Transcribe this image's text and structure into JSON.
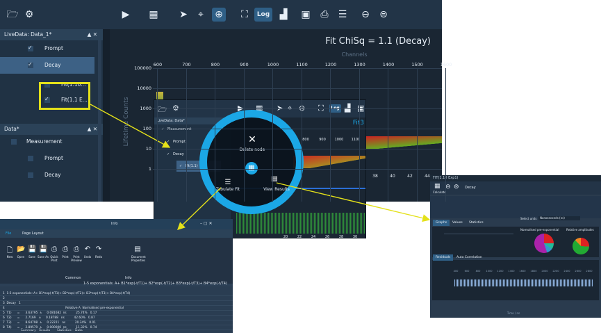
{
  "main": {
    "toolbar": {
      "log_label": "Log"
    },
    "panel_header": "LiveData: Data_1*",
    "tree": [
      {
        "label": "Prompt",
        "checked": true
      },
      {
        "label": "Decay",
        "checked": true
      },
      {
        "label": "Fit(1.10...",
        "checked": false
      },
      {
        "label": "Fit(1.1 E...",
        "checked": true
      }
    ],
    "data_header": "Data*",
    "data_items": [
      "Measurement",
      "Prompt",
      "Decay"
    ],
    "plot_title": "Fit ChiSq = 1.1 (Decay)",
    "x_axis_label": "Channels",
    "y_axis_label": "Lifetime Counts",
    "x_ticks": [
      "600",
      "700",
      "800",
      "900",
      "1000",
      "1100",
      "1200",
      "1300",
      "1400",
      "1500",
      "1600"
    ],
    "y_ticks": [
      "100000",
      "10000",
      "1000",
      "100",
      "10",
      "1"
    ]
  },
  "popup": {
    "toolbar": {
      "log_label": "Log"
    },
    "panel_header": "LiveData: Data*",
    "tree": [
      "Measurement",
      "Prompt",
      "Decay",
      "Fit(1.1)"
    ],
    "plot_title": "Fit3",
    "x_ticks": [
      "800",
      "900",
      "1000",
      "1100"
    ],
    "bottom_ticks": [
      "20",
      "22",
      "24",
      "26",
      "28",
      "30"
    ],
    "right_ticks": [
      "38",
      "40",
      "42",
      "44"
    ],
    "radial": {
      "delete": "Delete node",
      "tabulate": "Tabulate Fit",
      "view": "View Results"
    }
  },
  "excel": {
    "title": "Info",
    "tabs": [
      "File",
      "Page Layout"
    ],
    "buttons": [
      "New",
      "Open",
      "Save",
      "Save As",
      "Quick Print",
      "Print",
      "Print Preview",
      "Undo",
      "Redo",
      "Document Properties"
    ],
    "group_common": "Common",
    "group_info": "Info",
    "formula": "1-5 exponentials: A+ B1*exp(-t/T1)+ B2*exp(-t/T2)+ B3*exp(-t/T3)+ B4*exp(-t/T4)",
    "rows": [
      "1  1-5 exponentials: A+ B1*exp(-t/T1)+ B2*exp(-t/T2)+ B3*exp(-t/T3)+ B4*exp(-t/T4)",
      "2",
      "3  Decay   1",
      "4                                                                Relative A  Normalised pre-exponential",
      "5  T1)      =      3.63795  ±     0.081682  ns          25.74%   0.17",
      "6  T2)      =      2.7169   ±     0.18788   ns          42.60%   0.87",
      "7  T3)      =      8.64798  ±     0.22221   ns          20.34%   0.01",
      "8  T4)      =      2.89579  ±     0.000000  ns          11.32%   0.74"
    ],
    "sheet_tabs": [
      "Summary",
      "Results",
      "Statistics",
      "Data"
    ]
  },
  "results": {
    "title": "FIT(1.10 Exp1)",
    "calculate": "Calculate",
    "decay_label": "Decay",
    "select_units": "Select units",
    "units_value": "Nanoseconds (ns)",
    "tabs": [
      "Graphs",
      "Values",
      "Statistics"
    ],
    "chart_labels": [
      "Normalised pre-exponential",
      "Relative amplitudes"
    ],
    "lower_tabs": [
      "Residuals",
      "Auto Correlation"
    ],
    "x_axis_label": "Time / ns",
    "x_ticks": [
      "400",
      "600",
      "800",
      "1000",
      "1200",
      "1400",
      "1600",
      "1800",
      "2000",
      "2200",
      "2400",
      "2600",
      "2800"
    ]
  }
}
